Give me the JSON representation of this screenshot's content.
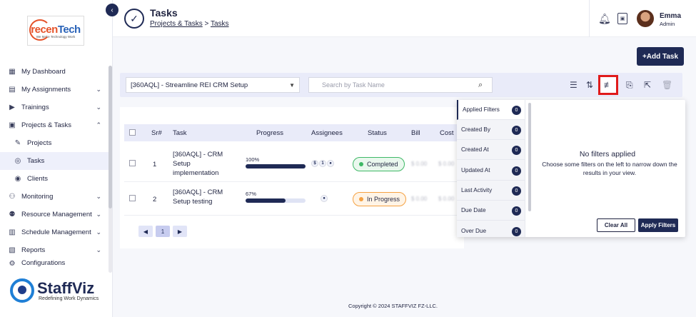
{
  "sidebar": {
    "logo": {
      "brand_a": "recen",
      "brand_b": "Tech",
      "tagline": "We Make Technology Work"
    },
    "items": [
      {
        "label": "My Dashboard",
        "icon": "dashboard-icon",
        "chevron": false
      },
      {
        "label": "My Assignments",
        "icon": "clipboard-icon",
        "chevron": true
      },
      {
        "label": "Trainings",
        "icon": "play-icon",
        "chevron": true
      },
      {
        "label": "Projects & Tasks",
        "icon": "folder-icon",
        "chevron": true
      },
      {
        "label": "Projects",
        "icon": "edit-icon",
        "chevron": false,
        "sub": true
      },
      {
        "label": "Tasks",
        "icon": "check-circle-icon",
        "chevron": false,
        "sub": true,
        "active": true
      },
      {
        "label": "Clients",
        "icon": "user-icon",
        "chevron": false,
        "sub": true
      },
      {
        "label": "Monitoring",
        "icon": "monitor-icon",
        "chevron": true
      },
      {
        "label": "Resource Management",
        "icon": "users-icon",
        "chevron": true
      },
      {
        "label": "Schedule Management",
        "icon": "calendar-icon",
        "chevron": true
      },
      {
        "label": "Reports",
        "icon": "report-icon",
        "chevron": true
      },
      {
        "label": "Configurations",
        "icon": "gear-icon",
        "chevron": false
      }
    ],
    "footer_brand": {
      "name": "StaffViz",
      "tagline": "Redefining Work Dynamics"
    }
  },
  "header": {
    "title": "Tasks",
    "breadcrumb_parent": "Projects & Tasks",
    "breadcrumb_sep": ">",
    "breadcrumb_current": "Tasks",
    "user_name": "Emma",
    "user_role": "Admin"
  },
  "main": {
    "add_task_label": "+Add Task",
    "project_select": "[360AQL] - Streamline REI CRM Setup",
    "search_placeholder": "Search by Task Name",
    "columns": [
      "Sr#",
      "Task",
      "Progress",
      "Assignees",
      "Status",
      "Bill",
      "Cost"
    ],
    "rows": [
      {
        "sr": "1",
        "task": "[360AQL] - CRM Setup implementation",
        "progress_label": "100%",
        "progress": 1.0,
        "assignees": [
          "$",
          "1",
          "●"
        ],
        "status": "Completed",
        "bill": "$ 0.00",
        "cost": "$ 0.00"
      },
      {
        "sr": "2",
        "task": "[360AQL] - CRM Setup testing",
        "progress_label": "67%",
        "progress": 0.67,
        "assignees": [
          "●"
        ],
        "status": "In Progress",
        "bill": "$ 0.00",
        "cost": "$ 0.00"
      }
    ],
    "pager": {
      "prev": "◀",
      "page": "1",
      "next": "▶"
    }
  },
  "filter_panel": {
    "items": [
      {
        "label": "Applied Filters",
        "count": "0"
      },
      {
        "label": "Created By",
        "count": "0"
      },
      {
        "label": "Created At",
        "count": "0"
      },
      {
        "label": "Updated At",
        "count": "0"
      },
      {
        "label": "Last Activity",
        "count": "0"
      },
      {
        "label": "Due Date",
        "count": "0"
      },
      {
        "label": "Over Due",
        "count": "0"
      }
    ],
    "empty_title": "No filters applied",
    "empty_desc": "Choose some filters on the left to narrow down the results in your view.",
    "clear_label": "Clear All",
    "apply_label": "Apply Filters"
  },
  "footer": {
    "copyright": "Copyright © 2024 STAFFVIZ FZ-LLC."
  },
  "colors": {
    "primary": "#1f2a55",
    "highlight": "#e01b1b",
    "completed": "#3fb866",
    "in_progress": "#f5a142"
  }
}
